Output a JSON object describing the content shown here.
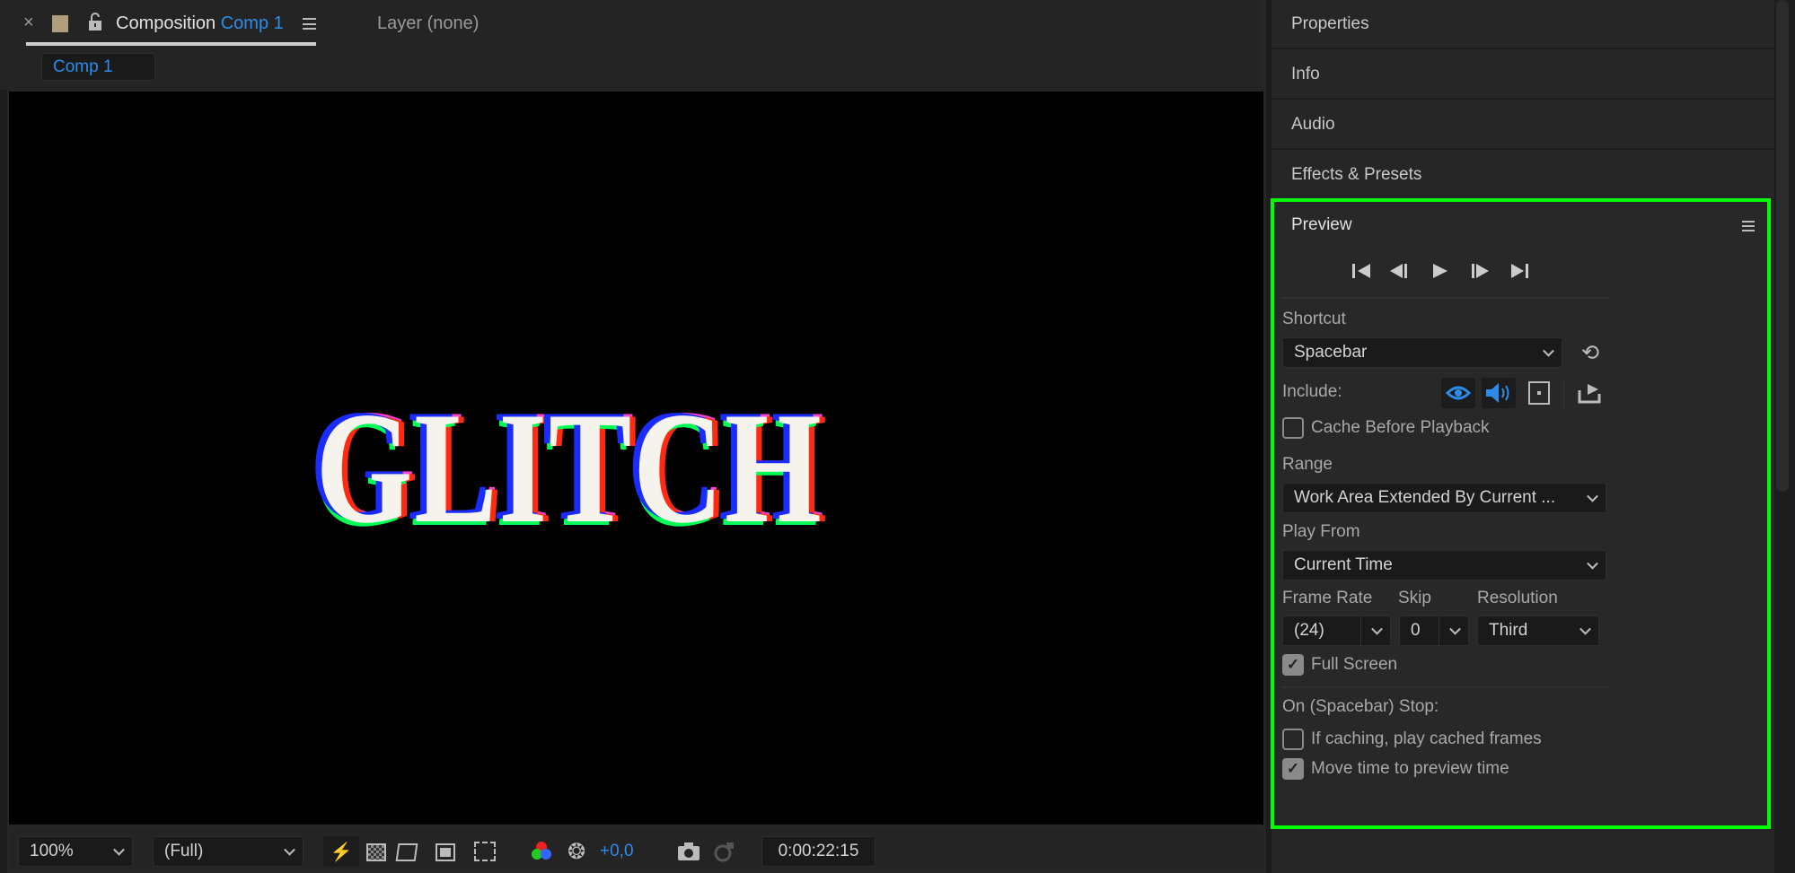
{
  "composition_panel": {
    "close": "×",
    "tab_prefix": "Composition",
    "tab_comp": "Comp 1",
    "layer_tab": "Layer (none)",
    "subtab": "Comp 1",
    "viewer_text": "GLITCH"
  },
  "viewer_toolbar": {
    "zoom": "100%",
    "resolution": "(Full)",
    "exposure": "+0,0",
    "timecode": "0:00:22:15"
  },
  "side_panels": [
    "Properties",
    "Info",
    "Audio",
    "Effects & Presets"
  ],
  "preview": {
    "title": "Preview",
    "shortcut_label": "Shortcut",
    "shortcut_value": "Spacebar",
    "include_label": "Include:",
    "cache_before_playback": {
      "label": "Cache Before Playback",
      "checked": false
    },
    "range_label": "Range",
    "range_value": "Work Area Extended By Current ...",
    "play_from_label": "Play From",
    "play_from_value": "Current Time",
    "frame_rate_label": "Frame Rate",
    "frame_rate_value": "(24)",
    "skip_label": "Skip",
    "skip_value": "0",
    "resolution_label": "Resolution",
    "resolution_value": "Third",
    "full_screen": {
      "label": "Full Screen",
      "checked": true
    },
    "on_stop_label": "On (Spacebar) Stop:",
    "if_caching": {
      "label": "If caching, play cached frames",
      "checked": false
    },
    "move_time": {
      "label": "Move time to preview time",
      "checked": true
    }
  },
  "colors": {
    "accent": "#2d8ceb",
    "highlight": "#00ff00"
  }
}
